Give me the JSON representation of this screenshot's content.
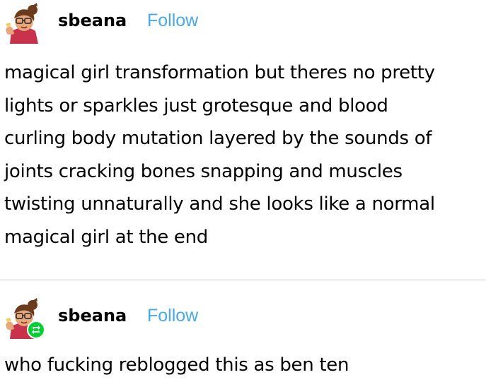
{
  "posts": [
    {
      "username": "sbeana",
      "follow_label": "Follow",
      "body": "magical girl transformation but theres no pretty\nlights or sparkles just grotesque and blood\ncurling body mutation layered by the sounds of\njoints cracking bones snapping and muscles\ntwisting unnaturally and she looks like a normal\nmagical girl at the end"
    },
    {
      "username": "sbeana",
      "follow_label": "Follow",
      "body": "who fucking reblogged this as ben ten",
      "badge_icon": "reblog-icon"
    }
  ],
  "colors": {
    "follow": "#4aa8e8",
    "reblog_badge": "#00cf35",
    "divider": "#cccccc"
  }
}
